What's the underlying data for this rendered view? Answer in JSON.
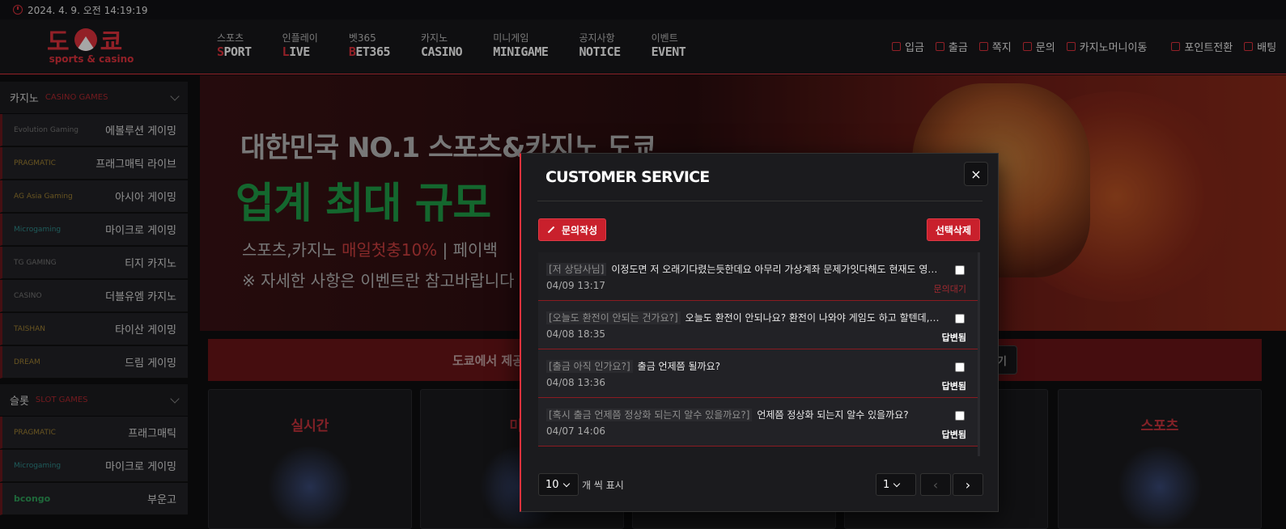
{
  "clock": "2024. 4. 9. 오전 14:19:19",
  "logo": {
    "main": "도쿄",
    "sub": "sports & casino"
  },
  "nav": [
    {
      "ko": "스포츠",
      "en_first": "S",
      "en_rest": "PORT"
    },
    {
      "ko": "인플레이",
      "en_first": "L",
      "en_rest": "IVE"
    },
    {
      "ko": "벳365",
      "en_first": "B",
      "en_rest": "ET365"
    },
    {
      "ko": "카지노",
      "en_first": "",
      "en_rest": "CASINO"
    },
    {
      "ko": "미니게임",
      "en_first": "",
      "en_rest": "MINIGAME"
    },
    {
      "ko": "공지사항",
      "en_first": "",
      "en_rest": "NOTICE"
    },
    {
      "ko": "이벤트",
      "en_first": "",
      "en_rest": "EVENT"
    }
  ],
  "top_menu": [
    "입금",
    "출금",
    "쪽지",
    "문의",
    "카지노머니이동",
    "포인트전환",
    "배팅"
  ],
  "sidebar": {
    "casino_head": {
      "ko": "카지노",
      "en": "CASINO GAMES"
    },
    "casino_items": [
      {
        "brand": "Evolution Gaming",
        "label": "에볼루션 게이밍"
      },
      {
        "brand": "PRAGMATIC",
        "label": "프래그매틱 라이브"
      },
      {
        "brand": "AG Asia Gaming",
        "label": "아시아 게이밍"
      },
      {
        "brand": "Microgaming",
        "label": "마이크로 게이밍"
      },
      {
        "brand": "TG GAMING",
        "label": "티지 카지노"
      },
      {
        "brand": "CASINO",
        "label": "더블유엠 카지노"
      },
      {
        "brand": "TAISHAN",
        "label": "타이산 게이밍"
      },
      {
        "brand": "DREAM",
        "label": "드림 게이밍"
      }
    ],
    "slot_head": {
      "ko": "슬롯",
      "en": "SLOT GAMES"
    },
    "slot_items": [
      {
        "brand": "PRAGMATIC",
        "label": "프래그매틱"
      },
      {
        "brand": "Microgaming",
        "label": "마이크로 게이밍"
      },
      {
        "brand": "bcongo",
        "label": "부운고"
      }
    ]
  },
  "banner": {
    "line1": "대한민국 NO.1 스포츠&카지노 도쿄",
    "line2": "업계 최대 규모",
    "line3_a": "스포츠,카지노 ",
    "line3_hl": "매일첫충10%",
    "line3_b": "  |  페이백 ",
    "line4": "※ 자세한 사항은 이벤트란 참고바랍니다"
  },
  "strip": {
    "text": "도쿄에서 제공",
    "button": "기"
  },
  "cards": [
    "실시간",
    "미니",
    "",
    "",
    "",
    "스포츠"
  ],
  "modal": {
    "title": "CUSTOMER SERVICE",
    "close": "×",
    "write_button": "문의작성",
    "delete_button": "선택삭제",
    "rows": [
      {
        "tag": "[저 상담사님]",
        "text": "이정도면 저 오래기다렸는듯한데요 아무리 가상계좌 문제가잇다해도 현재도 영업중이신데 …",
        "date": "04/09 13:17",
        "status": "문의대기",
        "waiting": true
      },
      {
        "tag": "[오늘도 환전이 안되는 건가요?]",
        "text": "오늘도 환전이 안되나요? 환전이 나와야 게임도 하고 할텐데,.;; 오늘…",
        "date": "04/08 18:35",
        "status": "답변됨",
        "waiting": false
      },
      {
        "tag": "[출금 아직 인가요?]",
        "text": "출금 언제쯤 될까요?",
        "date": "04/08 13:36",
        "status": "답변됨",
        "waiting": false
      },
      {
        "tag": "[혹시 출금 언제쯤 정상화 되는지 알수 있을까요?]",
        "text": "언제쯤 정상화 되는지 알수 있을까요?",
        "date": "04/07 14:06",
        "status": "답변됨",
        "waiting": false
      }
    ],
    "page_size": "10",
    "per_page_label": "개 씩 표시",
    "page": "1",
    "prev": "‹",
    "next": "›"
  },
  "colors": {
    "accent": "#e0323d",
    "bg": "#0e0e10",
    "panel": "#1b1b1e",
    "green": "#1f9e47"
  }
}
